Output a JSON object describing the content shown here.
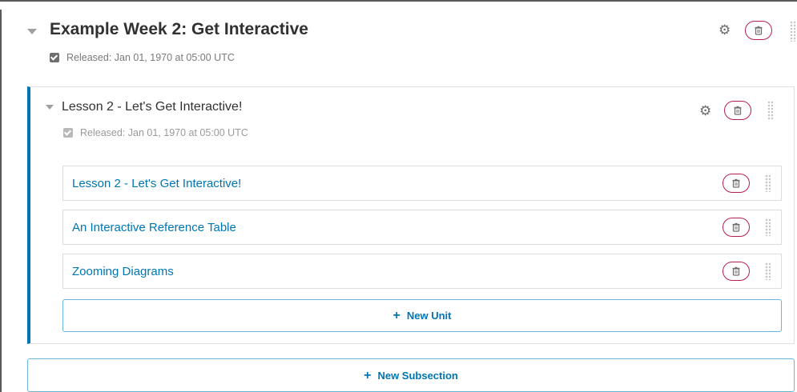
{
  "section": {
    "title": "Example Week 2: Get Interactive",
    "release": "Released: Jan 01, 1970 at 05:00 UTC",
    "released_checked": true
  },
  "subsection": {
    "title": "Lesson 2 - Let's Get Interactive!",
    "release": "Released: Jan 01, 1970 at 05:00 UTC",
    "released_checked": true,
    "units": [
      {
        "title": "Lesson 2 - Let's Get Interactive!"
      },
      {
        "title": "An Interactive Reference Table"
      },
      {
        "title": "Zooming Diagrams"
      }
    ],
    "new_unit_label": "New Unit"
  },
  "new_subsection_label": "New Subsection",
  "icons": {
    "caret": "caret-down-icon",
    "settings": "gear-icon",
    "delete": "trash-icon",
    "drag": "drag-handle-icon",
    "add": "plus-icon",
    "released": "checkbox-icon"
  },
  "colors": {
    "accent": "#0075b4",
    "delete": "#b41f4c",
    "button_border": "#6ab4db"
  }
}
